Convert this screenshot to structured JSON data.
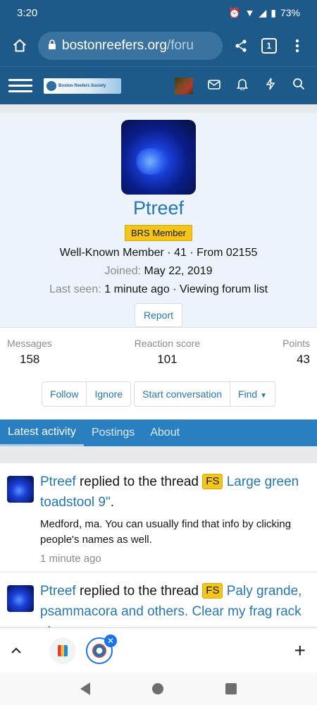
{
  "status_bar": {
    "time": "3:20",
    "battery": "73%"
  },
  "browser": {
    "url_host": "bostonreefers.org",
    "url_path": "/foru",
    "tab_count": "1"
  },
  "site": {
    "logo_text": "Boston Reefers Society"
  },
  "profile": {
    "username": "Ptreef",
    "badge": "BRS Member",
    "title": "Well-Known Member",
    "age": "41",
    "location": "From 02155",
    "joined_label": "Joined:",
    "joined_value": "May 22, 2019",
    "last_seen_label": "Last seen:",
    "last_seen_value": "1 minute ago",
    "last_seen_activity": "Viewing forum list",
    "report_label": "Report"
  },
  "stats": {
    "messages_label": "Messages",
    "messages_value": "158",
    "reaction_label": "Reaction score",
    "reaction_value": "101",
    "points_label": "Points",
    "points_value": "43"
  },
  "actions": {
    "follow": "Follow",
    "ignore": "Ignore",
    "start_conversation": "Start conversation",
    "find": "Find"
  },
  "tabs": [
    {
      "label": "Latest activity"
    },
    {
      "label": "Postings"
    },
    {
      "label": "About"
    }
  ],
  "activity": [
    {
      "user": "Ptreef",
      "action": " replied to the thread ",
      "prefix": "FS",
      "thread": "Large green toadstool 9\"",
      "snippet": "Medford, ma. You can usually find that info by clicking people's names as well.",
      "time": "1 minute ago"
    },
    {
      "user": "Ptreef",
      "action": " replied to the thread ",
      "prefix": "FS",
      "thread": "Paly grande, psammacora and others. Clear my frag rack please."
    }
  ],
  "colors": {
    "header_blue": "#1d5a8a",
    "tab_blue": "#2a7fc1",
    "link_blue": "#2577b1",
    "badge_yellow": "#f5c518",
    "profile_bg": "#edf3fb"
  }
}
